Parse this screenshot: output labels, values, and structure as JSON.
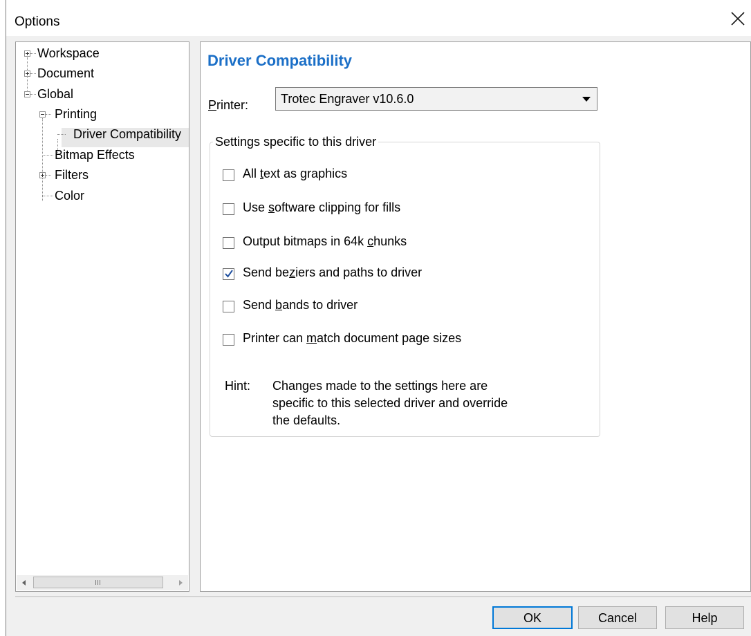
{
  "window": {
    "title": "Options"
  },
  "tree": {
    "items": [
      {
        "label": "Workspace",
        "expander": "plus"
      },
      {
        "label": "Document",
        "expander": "plus"
      },
      {
        "label": "Global",
        "expander": "minus"
      },
      {
        "label": "Printing",
        "expander": "minus"
      },
      {
        "label": "Driver Compatibility",
        "selected": true
      },
      {
        "label": "Bitmap Effects"
      },
      {
        "label": "Filters",
        "expander": "plus"
      },
      {
        "label": "Color"
      }
    ]
  },
  "content": {
    "heading": "Driver Compatibility",
    "heading_color": "#1b6fc7",
    "printer_label": "Printer:",
    "printer_value": "Trotec Engraver v10.6.0",
    "group_title": "Settings specific to this driver",
    "checkboxes": [
      {
        "label": "All text as graphics",
        "checked": false
      },
      {
        "label": "Use software clipping for fills",
        "checked": false
      },
      {
        "label": "Output bitmaps in 64k chunks",
        "checked": false
      },
      {
        "label": "Send beziers and paths to driver",
        "checked": true
      },
      {
        "label": "Send bands to driver",
        "checked": false
      },
      {
        "label": "Printer can match document page sizes",
        "checked": false
      }
    ],
    "hint_label": "Hint:",
    "hint_lines": [
      "Changes made to the settings here are",
      "specific to this selected driver and override",
      "the defaults."
    ]
  },
  "buttons": {
    "ok": "OK",
    "cancel": "Cancel",
    "help": "Help"
  }
}
